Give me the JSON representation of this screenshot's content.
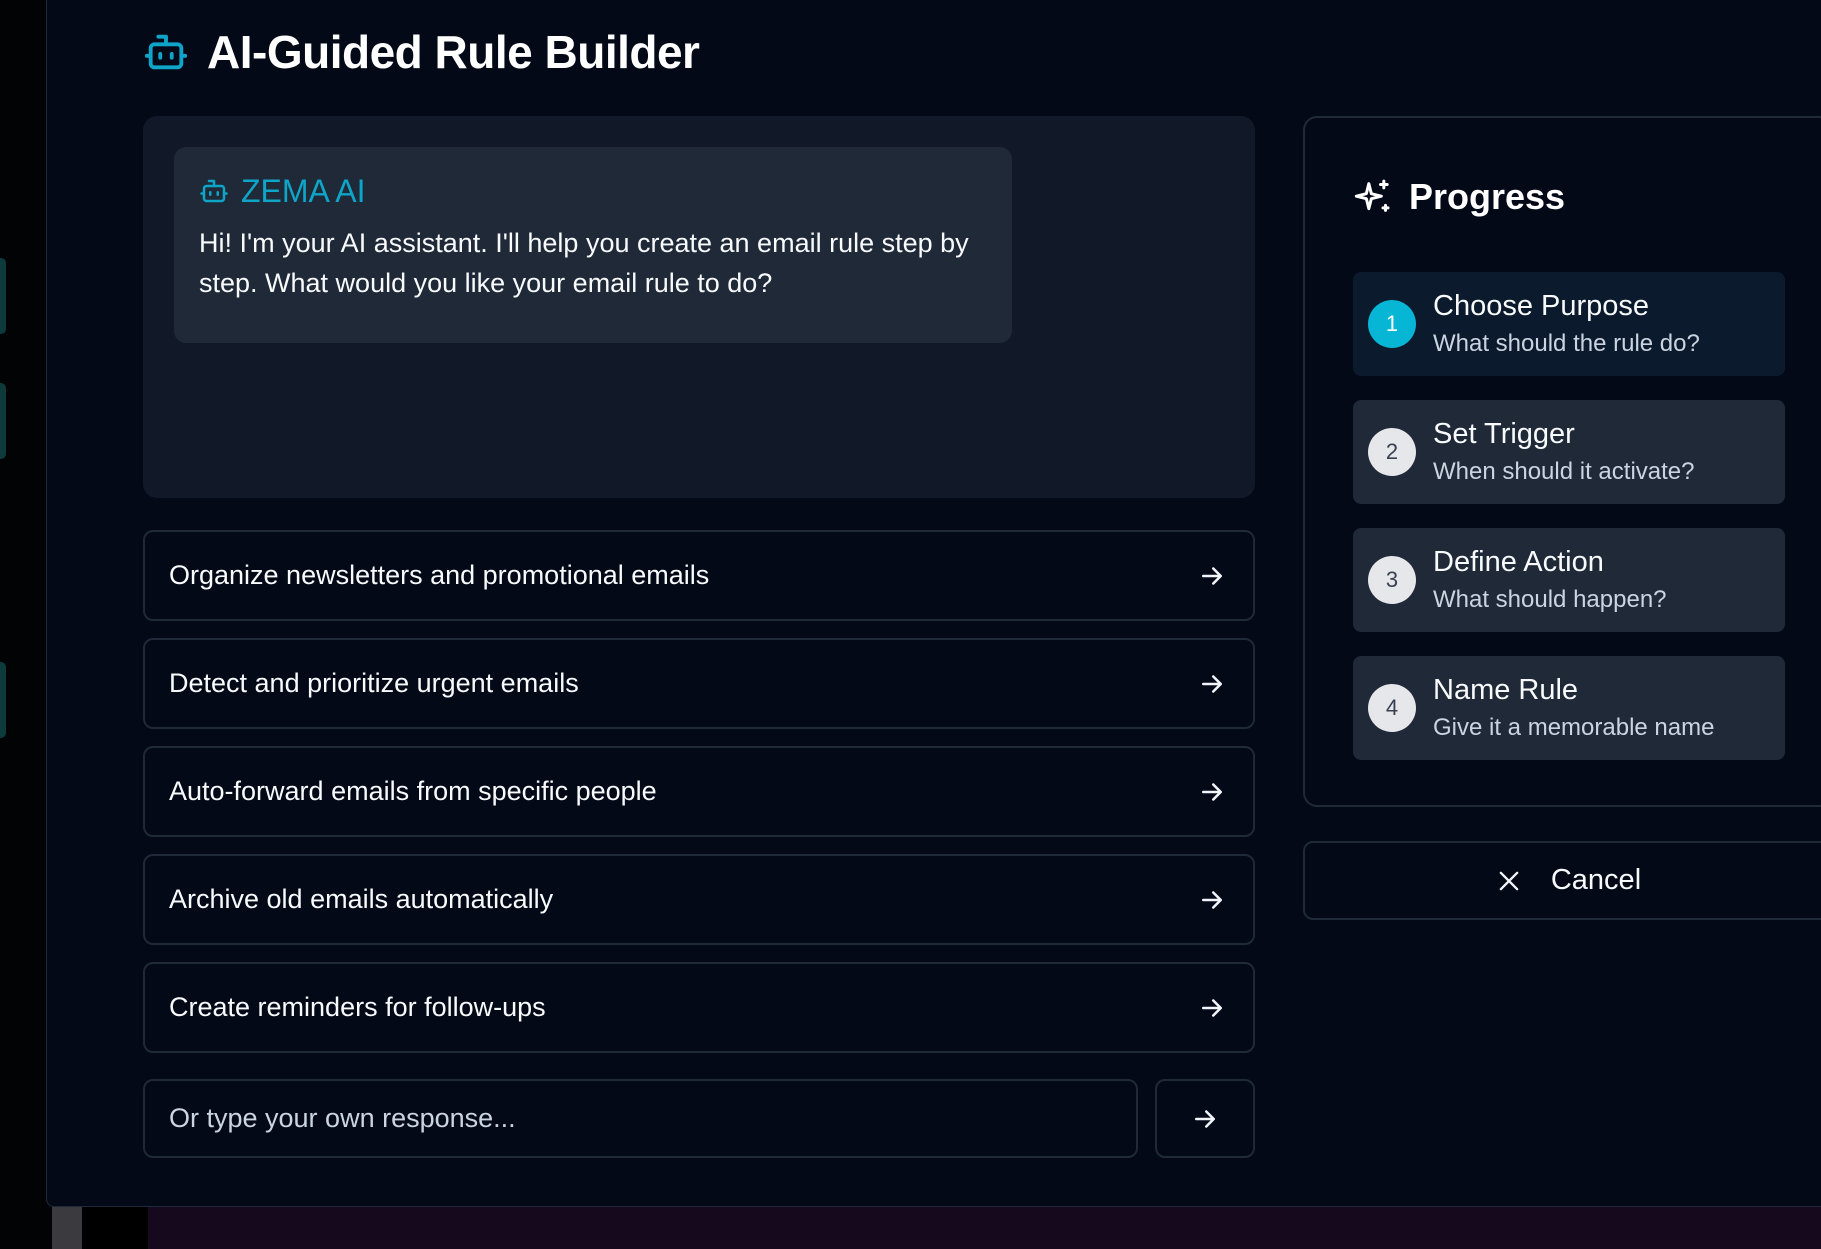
{
  "dialog": {
    "title": "AI-Guided Rule Builder",
    "icons": {
      "title": "robot-icon",
      "close": "close-icon"
    }
  },
  "chat": {
    "assistant_name": "ZEMA AI",
    "message": "Hi! I'm your AI assistant. I'll help you create an email rule step by step. What would you like your email rule to do?",
    "icon": "robot-icon"
  },
  "options": [
    {
      "label": "Organize newsletters and promotional emails",
      "icon": "arrow-right-icon"
    },
    {
      "label": "Detect and prioritize urgent emails",
      "icon": "arrow-right-icon"
    },
    {
      "label": "Auto-forward emails from specific people",
      "icon": "arrow-right-icon"
    },
    {
      "label": "Archive old emails automatically",
      "icon": "arrow-right-icon"
    },
    {
      "label": "Create reminders for follow-ups",
      "icon": "arrow-right-icon"
    }
  ],
  "response_input": {
    "value": "",
    "placeholder": "Or type your own response...",
    "send_icon": "arrow-right-icon"
  },
  "progress": {
    "title": "Progress",
    "icon": "sparkles-icon",
    "current_step": 1,
    "steps": [
      {
        "number": "1",
        "title": "Choose Purpose",
        "description": "What should the rule do?"
      },
      {
        "number": "2",
        "title": "Set Trigger",
        "description": "When should it activate?"
      },
      {
        "number": "3",
        "title": "Define Action",
        "description": "What should happen?"
      },
      {
        "number": "4",
        "title": "Name Rule",
        "description": "Give it a memorable name"
      }
    ]
  },
  "cancel": {
    "label": "Cancel",
    "icon": "close-icon"
  },
  "colors": {
    "accent": "#0ea5c9",
    "active_step": "#06b6d4",
    "dialog_bg": "#030917",
    "panel_bg": "#111827",
    "bubble_bg": "#1f2937",
    "border": "#1f2937"
  }
}
